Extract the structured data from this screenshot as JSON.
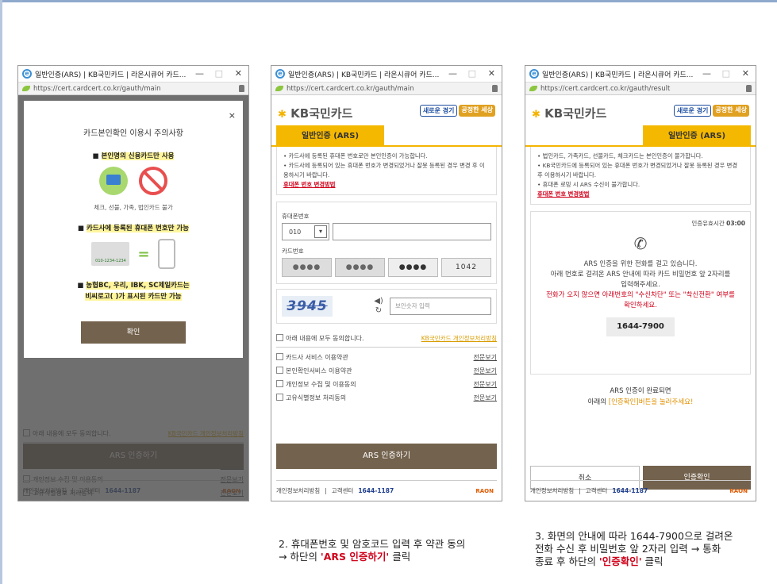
{
  "window_title": "일반인증(ARS) | KB국민카드 | 라온시큐어 카드...",
  "window_title_full": "일반인증(ARS) | KB국민카드 | 라온시큐어 카드본인확인",
  "window_controls": {
    "minimize": "—",
    "maximize": "□",
    "close": "✕"
  },
  "urls": {
    "main": "https://cert.cardcert.co.kr/gauth/main",
    "result": "https://cert.cardcert.co.kr/gauth/result"
  },
  "brand": {
    "logo": "KB국민카드",
    "slogan1": "새로운 경기",
    "slogan2": "공정한 세상"
  },
  "tab_label": "일반인증 (ARS)",
  "modal": {
    "title": "카드본인확인 이용시 주의사항",
    "close": "×",
    "bullet1": "본인명의 신용카드만 사용",
    "bullet1_sub": "체크, 선불, 가족, 법인카드 불가",
    "bullet2": "카드사에 등록된 휴대폰 번호만 가능",
    "phone_sample": "010-1234-1234",
    "bullet3_line1": "농협BC, 우리, IBK, SC제일카드는",
    "bullet3_line2": "비씨로고(  )가 표시된 카드만 가능",
    "confirm": "확인"
  },
  "notice": {
    "w2_line1": "• 카드사에 등록된 휴대폰 번호로만 본인인증이 가능합니다.",
    "w2_line2": "• 카드사에 등록되어 있는 휴대폰 번호가 변경되었거나 잘못 등록된 경우 변경 후 이용하시기 바랍니다.",
    "w3_line1": "• 법인카드, 가족카드, 선불카드, 체크카드는 본인인증이 불가합니다.",
    "w3_line2": "• KB국민카드에 등록되어 있는 휴대폰 번호가 변경되었거나 잘못 등록된 경우 변경 후 이용하시기 바랍니다.",
    "w3_line3": "• 휴대폰 로밍 시 ARS 수신이 불가합니다.",
    "link": "휴대폰 번호 변경방법"
  },
  "form": {
    "phone_label": "휴대폰번호",
    "phone_prefix": "010",
    "card_label": "카드번호",
    "card_boxes": [
      "●●●●",
      "●●●●",
      "●●●●",
      "1042"
    ],
    "captcha": "3945",
    "captcha_placeholder": "보안숫자 입력"
  },
  "agreement": {
    "all": "아래 내용에 모두 동의합니다.",
    "privacy_link": "KB국민카드 개인정보처리방침",
    "items": [
      "카드사 서비스 이용약관",
      "본인확인서비스 이용약관",
      "개인정보 수집 및 이용동의",
      "고유식별정보 처리동의"
    ],
    "view": "전문보기"
  },
  "ars_button": "ARS 인증하기",
  "footer": {
    "privacy": "개인정보처리방침",
    "sep": "|",
    "center": "고객센터",
    "number": "1644-1187",
    "logo": "RAON"
  },
  "ars": {
    "timer_label": "인증유효시간",
    "timer": "03:00",
    "line1": "ARS 인증을 위한 전화를 걸고 있습니다.",
    "line2": "아래 번호로 걸려온 ARS 안내에 따라 카드 비밀번호 앞 2자리를",
    "line3": "입력해주세요.",
    "red1": "전화가 오지 않으면 아래번호의 \"수신차단\" 또는 \"착신전환\" 여부를",
    "red2": "확인하세요.",
    "number": "1644-7900",
    "done1": "ARS 인증이 완료되면",
    "done2a": "아래의 ",
    "done2b": "[인증확인]버튼을 눌러주세요!",
    "cancel": "취소",
    "confirm": "인증확인"
  },
  "captions": {
    "c2_line1": "2. 휴대폰번호 및 암호코드 입력 후 약관 동의",
    "c2_line2a": "→ 하단의 ",
    "c2_line2b": "'ARS 인증하기'",
    "c2_line2c": " 클릭",
    "c3_line1": "3. 화면의 안내에 따라 1644-7900으로 걸려온",
    "c3_line2": "전화 수신 후 비밀번호 앞 2자리 입력 → 통화",
    "c3_line3a": "종료 후 하단의 ",
    "c3_line3b": "'인증확인'",
    "c3_line3c": " 클릭"
  }
}
